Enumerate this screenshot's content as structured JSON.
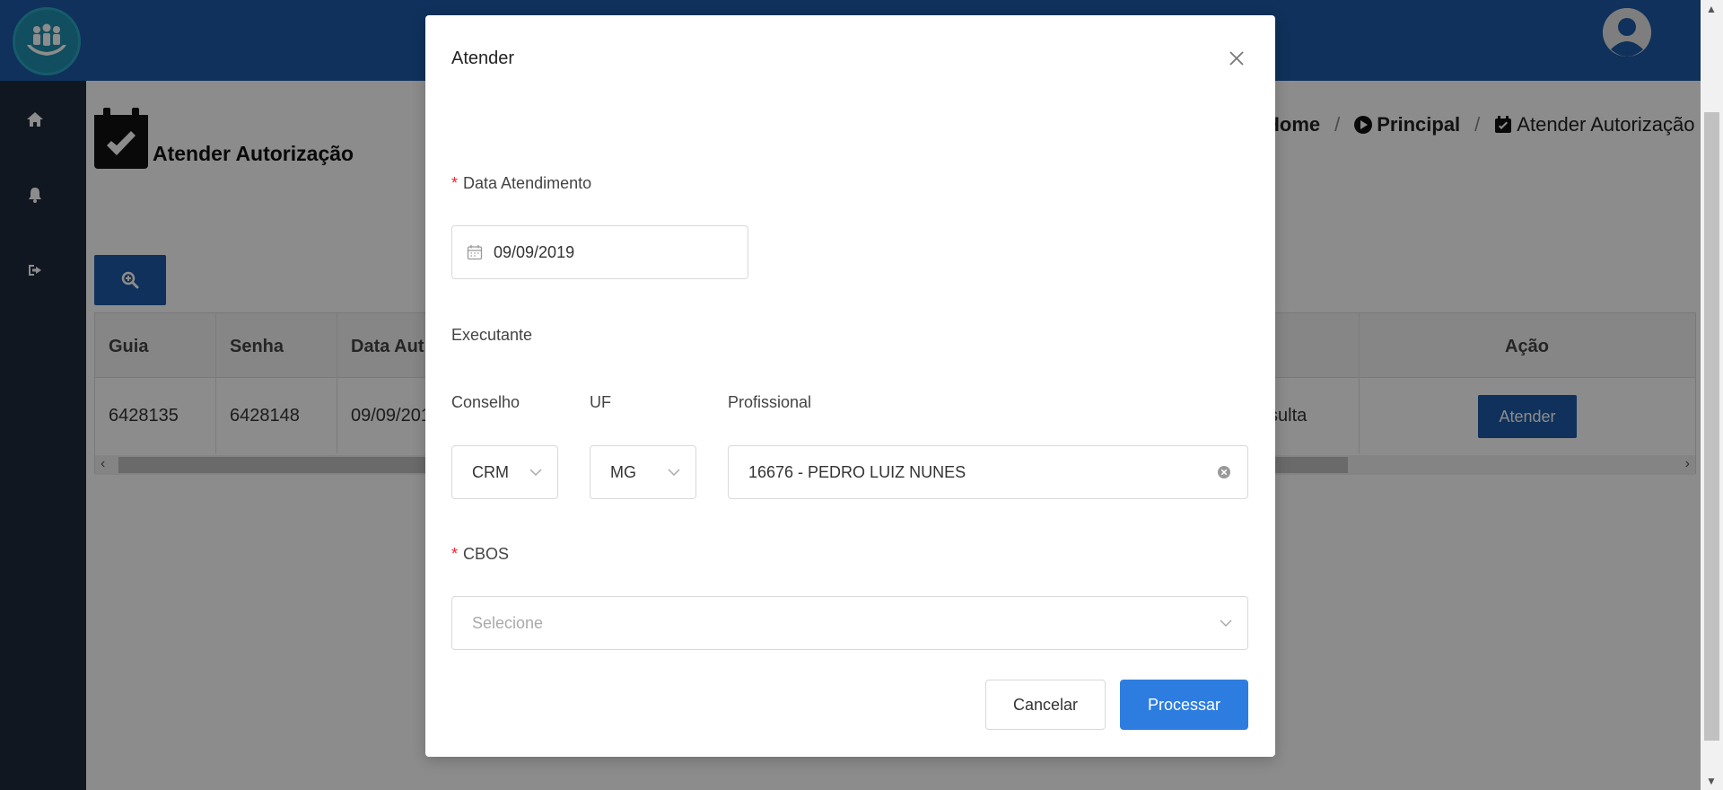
{
  "header": {
    "logo_icon": "family-hands-logo",
    "user_icon": "user-avatar-icon"
  },
  "sidebar": {
    "items": [
      {
        "icon": "home-icon"
      },
      {
        "icon": "bell-icon"
      },
      {
        "icon": "sign-out-icon"
      }
    ]
  },
  "page": {
    "title": "Atender Autorização",
    "breadcrumb": {
      "home": "Home",
      "principal": "Principal",
      "current": "Atender Autorização",
      "separator": "/"
    }
  },
  "table": {
    "headers": {
      "guia": "Guia",
      "senha": "Senha",
      "data": "Data Aut",
      "acao": "Ação"
    },
    "row": {
      "guia": "6428135",
      "senha": "6428148",
      "data": "09/09/201",
      "tipo": "sulta",
      "action_label": "Atender"
    }
  },
  "modal": {
    "title": "Atender",
    "data_atendimento": {
      "label": "Data Atendimento",
      "required_mark": "*",
      "value": "09/09/2019"
    },
    "executante_label": "Executante",
    "conselho": {
      "label": "Conselho",
      "value": "CRM"
    },
    "uf": {
      "label": "UF",
      "value": "MG"
    },
    "profissional": {
      "label": "Profissional",
      "value": "16676 - PEDRO LUIZ NUNES"
    },
    "cbos": {
      "label": "CBOS",
      "required_mark": "*",
      "placeholder": "Selecione"
    },
    "cancel_label": "Cancelar",
    "process_label": "Processar"
  },
  "colors": {
    "header_blue": "#1c5aa6",
    "sidebar_dark": "#1f2a3b",
    "primary_button": "#2d7de0",
    "required_red": "#f5222d"
  }
}
